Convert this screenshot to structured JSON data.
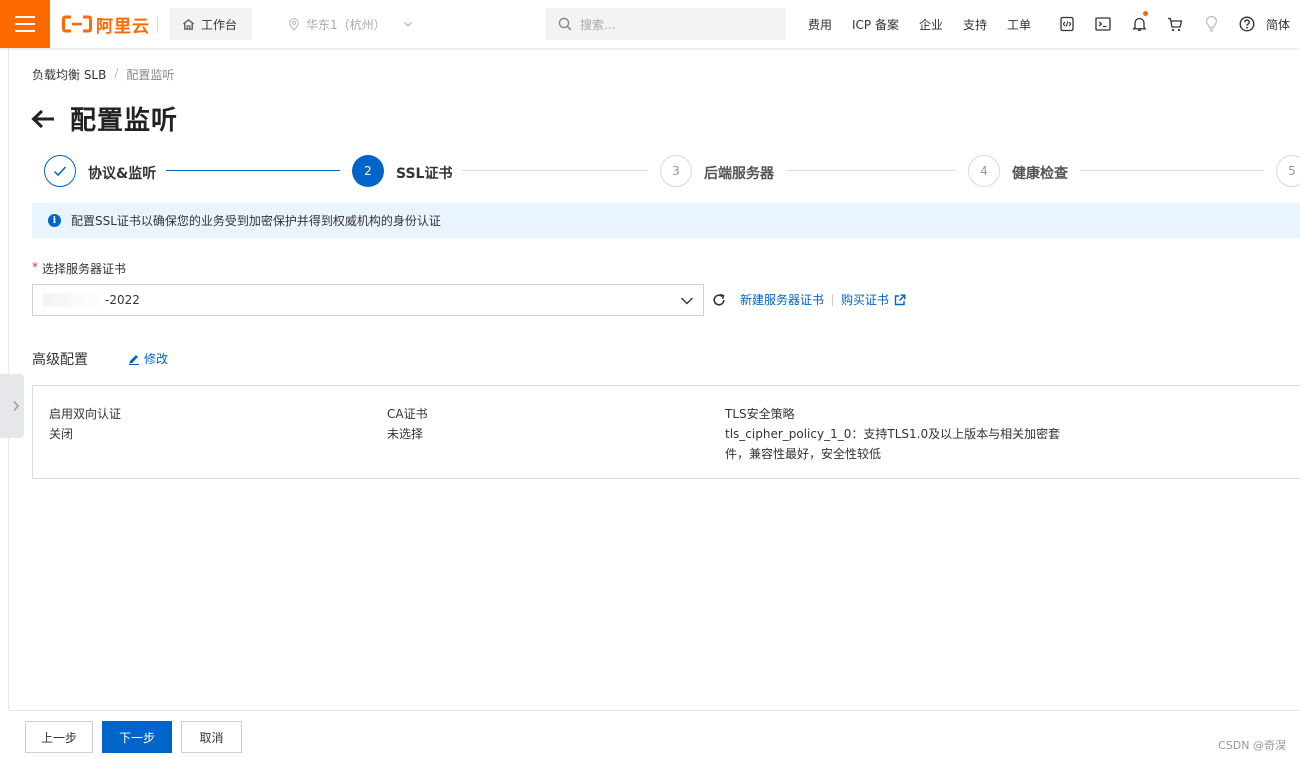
{
  "topbar": {
    "logo_text": "阿里云",
    "workbench_label": "工作台",
    "region_label": "华东1（杭州）",
    "search_placeholder": "搜索...",
    "links": [
      "费用",
      "ICP 备案",
      "企业",
      "支持",
      "工单"
    ],
    "language": "简体",
    "icons": [
      "code-icon",
      "terminal-icon",
      "bell-icon",
      "cart-icon",
      "lightbulb-icon",
      "help-icon"
    ]
  },
  "breadcrumb": {
    "parent": "负载均衡 SLB",
    "separator": "/",
    "current": "配置监听"
  },
  "page": {
    "title": "配置监听"
  },
  "steps": [
    {
      "number": "1",
      "label": "协议&监听",
      "state": "done"
    },
    {
      "number": "2",
      "label": "SSL证书",
      "state": "active"
    },
    {
      "number": "3",
      "label": "后端服务器",
      "state": "todo"
    },
    {
      "number": "4",
      "label": "健康检查",
      "state": "todo"
    },
    {
      "number": "5",
      "label": "",
      "state": "todo"
    }
  ],
  "info_banner": {
    "text": "配置SSL证书以确保您的业务受到加密保护并得到权威机构的身份认证"
  },
  "form": {
    "cert_label": "选择服务器证书",
    "required_mark": "*",
    "cert_value": "-2022",
    "new_cert_link": "新建服务器证书",
    "buy_cert_link": "购买证书"
  },
  "advanced": {
    "title": "高级配置",
    "edit_label": "修改",
    "items": [
      {
        "key": "启用双向认证",
        "value": "关闭"
      },
      {
        "key": "CA证书",
        "value": "未选择"
      },
      {
        "key": "TLS安全策略",
        "value_line1": "tls_cipher_policy_1_0：支持TLS1.0及以上版本与相关加密套",
        "value_line2": "件，兼容性最好，安全性较低"
      }
    ]
  },
  "footer": {
    "prev_label": "上一步",
    "next_label": "下一步",
    "cancel_label": "取消",
    "watermark": "CSDN @奇淏"
  },
  "colors": {
    "brand": "#ff6a00",
    "primary": "#0064c8",
    "banner_bg": "#e9f4fe",
    "required": "#d93026"
  }
}
